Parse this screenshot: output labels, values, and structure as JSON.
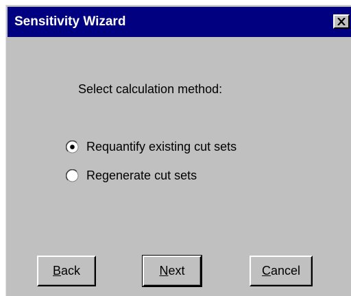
{
  "window": {
    "title": "Sensitivity Wizard",
    "close_glyph": "✕"
  },
  "prompt": "Select calculation method:",
  "options": [
    {
      "label": "Requantify existing cut sets",
      "selected": true
    },
    {
      "label": "Regenerate cut sets",
      "selected": false
    }
  ],
  "buttons": {
    "back": {
      "mnemonic": "B",
      "rest": "ack"
    },
    "next": {
      "mnemonic": "N",
      "rest": "ext"
    },
    "cancel": {
      "mnemonic": "C",
      "rest": "ancel"
    }
  },
  "colors": {
    "titlebar": "#000080",
    "face": "#c0c0c0"
  }
}
